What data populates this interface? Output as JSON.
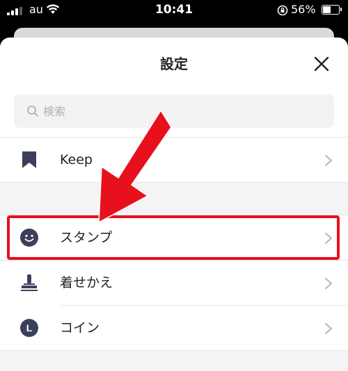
{
  "status_bar": {
    "carrier": "au",
    "time": "10:41",
    "battery": "56%",
    "battery_level": 0.56
  },
  "sheet": {
    "title": "設定",
    "search": {
      "placeholder": "検索",
      "value": ""
    },
    "items": [
      {
        "label": "Keep",
        "icon": "bookmark-icon"
      },
      {
        "label": "スタンプ",
        "icon": "smiley-icon"
      },
      {
        "label": "着せかえ",
        "icon": "brush-icon"
      },
      {
        "label": "コイン",
        "icon": "coin-icon",
        "icon_text": "L"
      }
    ]
  },
  "annotation": {
    "color": "#e8101c",
    "highlighted_item": "スタンプ"
  },
  "colors": {
    "icon": "#3c3f5c",
    "chevron": "#b5b5b5",
    "divider": "#e4e4e4",
    "band": "#f4f4f6"
  }
}
